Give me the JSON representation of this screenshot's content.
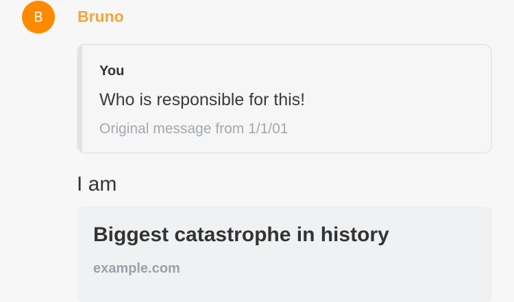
{
  "message": {
    "sender": {
      "avatar_initial": "B",
      "name": "Bruno",
      "avatar_color": "#ff8a00",
      "name_color": "#f7a33c"
    },
    "quoted": {
      "author": "You",
      "text": "Who is responsible for this!",
      "meta": "Original message from 1/1/01"
    },
    "body": "I am",
    "link_preview": {
      "title": "Biggest catastrophe in history",
      "domain": "example.com"
    }
  }
}
